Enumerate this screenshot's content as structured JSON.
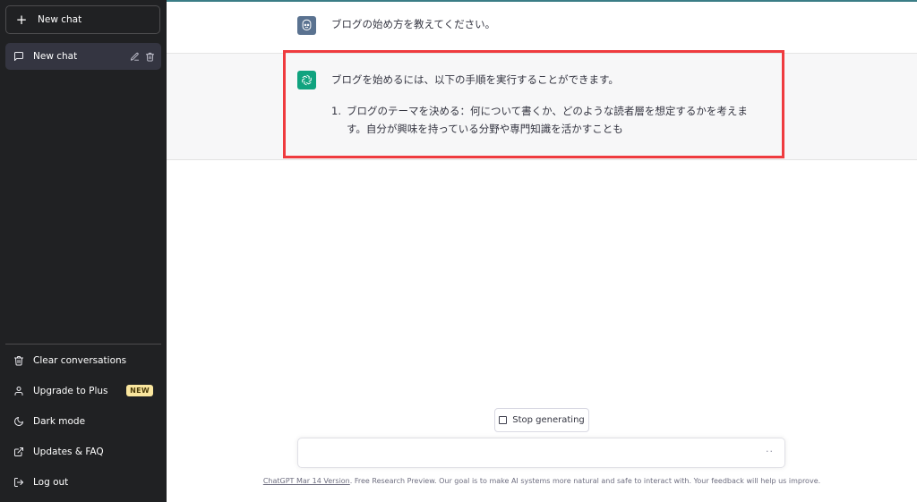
{
  "sidebar": {
    "new_chat_label": "New chat",
    "conversations": [
      {
        "label": "New chat"
      }
    ],
    "menu": {
      "clear": "Clear conversations",
      "upgrade": "Upgrade to Plus",
      "upgrade_badge": "NEW",
      "dark": "Dark mode",
      "updates": "Updates & FAQ",
      "logout": "Log out"
    }
  },
  "conversation": {
    "user_message": "ブログの始め方を教えてください。",
    "assistant_intro": "ブログを始めるには、以下の手順を実行することができます。",
    "assistant_list": [
      {
        "number": "1.",
        "text": "ブログのテーマを決める：何について書くか、どのような読者層を想定するかを考えます。自分が興味を持っている分野や専門知識を活かすことも"
      }
    ]
  },
  "composer": {
    "stop_label": "Stop generating",
    "input_value": "",
    "typing_indicator": "··"
  },
  "footer": {
    "link_text": "ChatGPT Mar 14 Version",
    "text": ". Free Research Preview. Our goal is to make AI systems more natural and safe to interact with. Your feedback will help us improve."
  },
  "colors": {
    "sidebar_bg": "#202123",
    "active_item_bg": "#343541",
    "assistant_avatar": "#10a37f",
    "user_avatar": "#5a7290",
    "highlight": "#ef3b3f",
    "badge_bg": "#fae69e"
  },
  "icons": {
    "new_chat": "plus-icon",
    "conversation": "chat-bubble-icon",
    "edit": "pencil-icon",
    "delete": "trash-icon",
    "clear": "trash-icon",
    "upgrade": "user-icon",
    "dark": "moon-icon",
    "updates": "external-link-icon",
    "logout": "logout-icon"
  }
}
